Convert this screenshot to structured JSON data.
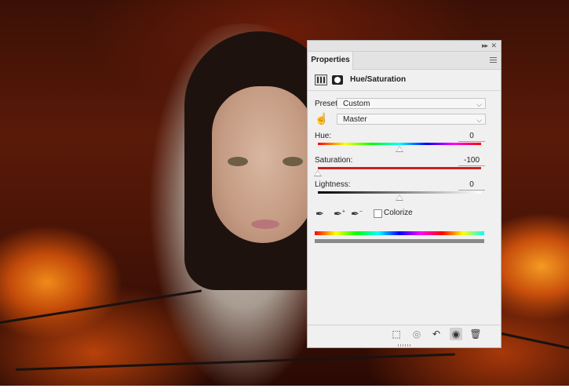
{
  "panel": {
    "tab_label": "Properties",
    "collapse_icon": "double-chevron-right-icon",
    "close_icon": "close-icon",
    "menu_icon": "hamburger-menu-icon"
  },
  "adjustment": {
    "title": "Hue/Saturation",
    "layer_icon": "adjustment-layer-icon",
    "mask_icon": "layer-mask-icon"
  },
  "preset": {
    "label": "Preset:",
    "value": "Custom"
  },
  "channel": {
    "value": "Master",
    "tool_icon": "targeted-adjustment-hand-icon"
  },
  "sliders": {
    "hue": {
      "label": "Hue:",
      "value": "0",
      "position": 0.5
    },
    "saturation": {
      "label": "Saturation:",
      "value": "-100",
      "position": 0.0
    },
    "lightness": {
      "label": "Lightness:",
      "value": "0",
      "position": 0.5
    }
  },
  "tools": {
    "dropper_icons": [
      "eyedropper-icon",
      "eyedropper-plus-icon",
      "eyedropper-minus-icon"
    ],
    "colorize_label": "Colorize",
    "colorize_checked": false
  },
  "bottom_icons": [
    "clip-to-layer-icon",
    "view-previous-state-icon",
    "reset-icon",
    "visibility-eye-icon",
    "trash-icon"
  ],
  "colors": {
    "panel_bg": "#f0f0f0",
    "saturation_track": "#cc1f1f"
  }
}
